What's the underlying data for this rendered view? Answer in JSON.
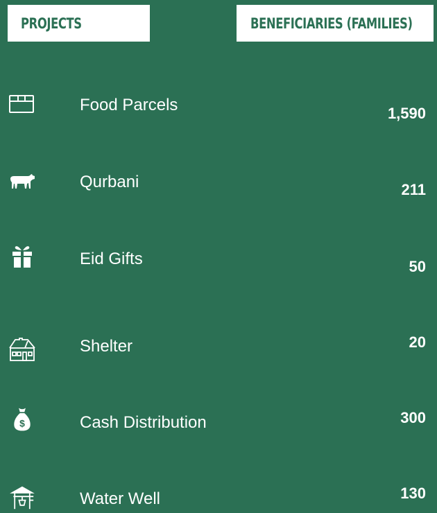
{
  "headers": {
    "projects": "PROJECTS",
    "beneficiaries": "BENEFICIARIES (FAMILIES)"
  },
  "colors": {
    "background": "#2b7054",
    "header_background": "#ffffff",
    "text": "#ffffff"
  },
  "projects": [
    {
      "icon": "food-parcel-box-icon",
      "name": "Food Parcels",
      "beneficiaries": "1,590"
    },
    {
      "icon": "cow-icon",
      "name": "Qurbani",
      "beneficiaries": "211"
    },
    {
      "icon": "gift-icon",
      "name": "Eid Gifts",
      "beneficiaries": "50"
    },
    {
      "icon": "house-icon",
      "name": "Shelter",
      "beneficiaries": "20"
    },
    {
      "icon": "money-bag-icon",
      "name": "Cash Distribution",
      "beneficiaries": "300"
    },
    {
      "icon": "water-well-icon",
      "name": "Water Well",
      "beneficiaries": "130"
    }
  ]
}
